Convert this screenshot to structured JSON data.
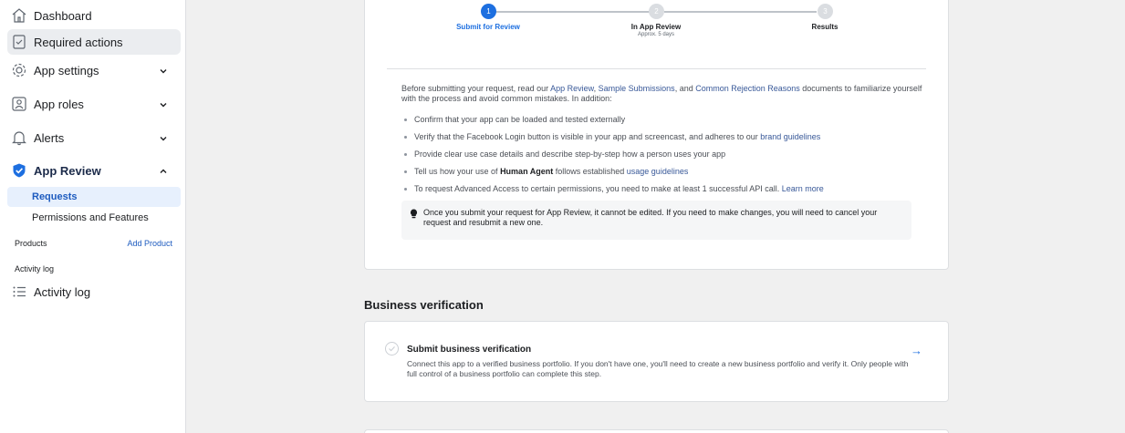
{
  "sidebar": {
    "items": [
      {
        "label": "Dashboard",
        "icon": "home-icon"
      },
      {
        "label": "Required actions",
        "icon": "clipboard-check-icon"
      },
      {
        "label": "App settings",
        "icon": "gear-icon"
      },
      {
        "label": "App roles",
        "icon": "person-badge-icon"
      },
      {
        "label": "Alerts",
        "icon": "bell-icon"
      },
      {
        "label": "App Review",
        "icon": "shield-check-icon"
      }
    ],
    "sub_items": [
      "Requests",
      "Permissions and Features"
    ],
    "products_label": "Products",
    "add_product": "Add Product",
    "activity_section_label": "Activity log",
    "activity_item": "Activity log"
  },
  "stepper": {
    "steps": [
      {
        "number": "1",
        "label": "Submit for Review",
        "sub": ""
      },
      {
        "number": "2",
        "label": "In App Review",
        "sub": "Approx. 5 days"
      },
      {
        "number": "3",
        "label": "Results",
        "sub": ""
      }
    ]
  },
  "review": {
    "intro_before": "Before submitting your request, read our ",
    "link_app_review": "App Review",
    "sep1": ", ",
    "link_samples": "Sample Submissions",
    "sep2": ", and ",
    "link_rejection": "Common Rejection Reasons",
    "intro_after": " documents to familiarize yourself with the process and avoid common mistakes. In addition:",
    "bullet1": "Confirm that your app can be loaded and tested externally",
    "bullet2_text": "Verify that the Facebook Login button is visible in your app and screencast, and adheres to our ",
    "bullet2_link": "brand guidelines",
    "bullet3": "Provide clear use case details and describe step-by-step how a person uses your app",
    "bullet4_before": "Tell us how your use of ",
    "bullet4_bold": "Human Agent",
    "bullet4_mid": " follows established ",
    "bullet4_link": "usage guidelines",
    "bullet5_text": "To request Advanced Access to certain permissions, you need to make at least 1 successful API call. ",
    "bullet5_link": "Learn more",
    "notice": "Once you submit your request for App Review, it cannot be edited. If you need to make changes, you will need to cancel your request and resubmit a new one."
  },
  "business": {
    "heading": "Business verification",
    "title": "Submit business verification",
    "description": "Connect this app to a verified business portfolio. If you don't have one, you'll need to create a new business portfolio and verify it. Only people with full control of a business portfolio can complete this step.",
    "arrow": "→"
  },
  "colors": {
    "accent": "#1d6fe0",
    "link": "#385898",
    "background": "#f0f0f0"
  }
}
